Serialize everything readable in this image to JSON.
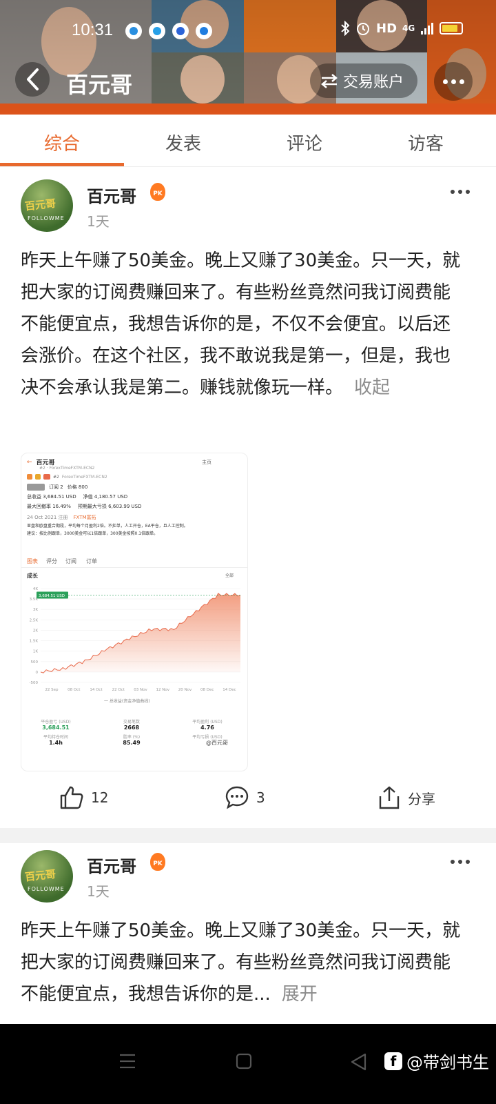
{
  "status_bar": {
    "time": "10:31",
    "network": "HD",
    "signal": "4G",
    "icons": [
      "weather-app-icon",
      "cloud-app-icon",
      "baidu-app-icon",
      "k-app-icon",
      "bluetooth-icon",
      "alarm-icon",
      "signal-icon",
      "battery-icon"
    ]
  },
  "header": {
    "title": "百元哥",
    "trade_account_label": "交易账户",
    "accent": "#e8581c"
  },
  "tabs": [
    {
      "label": "综合",
      "active": true
    },
    {
      "label": "发表",
      "active": false
    },
    {
      "label": "评论",
      "active": false
    },
    {
      "label": "访客",
      "active": false
    }
  ],
  "posts": [
    {
      "author": "百元哥",
      "badge": "PK",
      "time": "1天",
      "text": "昨天上午赚了50美金。晚上又赚了30美金。只一天，就把大家的订阅费赚回来了。有些粉丝竟然问我订阅费能不能便宜点，我想告诉你的是，不仅不会便宜。以后还会涨价。在这个社区，我不敢说我是第一，但是，我也决不会承认我是第二。赚钱就像玩一样。",
      "toggle": "收起",
      "likes": "12",
      "comments": "3",
      "share": "分享"
    },
    {
      "author": "百元哥",
      "badge": "PK",
      "time": "1天",
      "text": "昨天上午赚了50美金。晚上又赚了30美金。只一天，就把大家的订阅费赚回来了。有些粉丝竟然问我订阅费能不能便宜点，我想告诉你的是...",
      "toggle": "展开"
    }
  ],
  "avatar_text": {
    "sign": "百元哥",
    "sub": "FOLLOWME"
  },
  "embedded_shot": {
    "account_name": "百元哥",
    "account_sub": "#2 · ForexTimeFXTM-ECN2",
    "home_label": "主页",
    "tag": "#2",
    "sub_id": "ForexTimeFXTM-ECN2",
    "subscribe": "订阅 2",
    "price": "价格 800",
    "total_profit": "总收益 3,684.51 USD",
    "net_value": "净值 4,180.57 USD",
    "max_drawdown": "最大回撤率 16.49%",
    "deposit": "预期最大亏损 6,603.99 USD",
    "date_line": "24 Oct 2021 注册",
    "broker": "FXTM富拓",
    "desc1": "亚盘和欧盘重合期段，平均每个月盈利2倍。不扛单，人工开仓，EA平仓，且人工控制。",
    "desc2": "建议：按比例跟单，3000美金可以1倍跟单，300美金按照0.1倍跟单。",
    "tabs": [
      "图表",
      "评分",
      "订阅",
      "订单"
    ],
    "chart_title": "成长",
    "chart_filter": "全部",
    "peak_label": "3,684.51 USD",
    "legend": "一 总收益(资金净值曲线)",
    "stats": [
      {
        "k": "平仓盈亏 (USD)",
        "v": "3,684.51"
      },
      {
        "k": "交易笔数",
        "v": "2668"
      },
      {
        "k": "平均盈利 (USD)",
        "v": "4.76"
      },
      {
        "k": "平均持仓时间",
        "v": "1.4h"
      },
      {
        "k": "胜率 (%)",
        "v": "85.49"
      },
      {
        "k": "平均亏损 (USD)",
        "v": ""
      }
    ],
    "watermark": "@百元哥"
  },
  "chart_data": {
    "type": "area",
    "title": "成长",
    "x": [
      "22 Sep",
      "08 Oct",
      "14 Oct",
      "22 Oct",
      "03 Nov",
      "12 Nov",
      "20 Nov",
      "08 Dec",
      "14 Dec"
    ],
    "y_ticks": [
      "4K",
      "3.5K",
      "3K",
      "2.5K",
      "2K",
      "1.5K",
      "1K",
      "500",
      "0",
      "-500"
    ],
    "series": [
      {
        "values": [
          0,
          150,
          520,
          1100,
          1600,
          2050,
          2050,
          2900,
          3700,
          3684.51
        ]
      }
    ],
    "ylim": [
      -500,
      4000
    ],
    "color": "#f08c6a"
  },
  "watermark_bottom": "@带剑书生"
}
